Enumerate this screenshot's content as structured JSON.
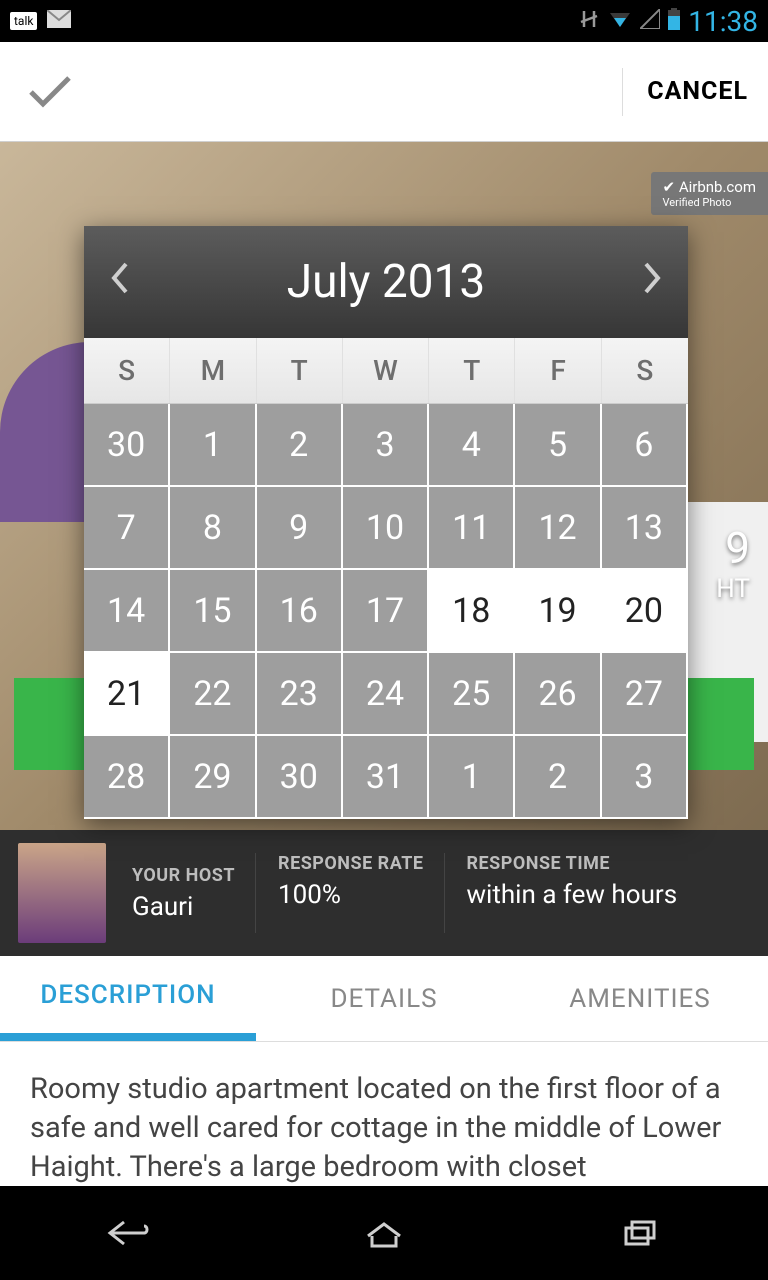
{
  "status": {
    "talk_label": "talk",
    "time": "11:38"
  },
  "appbar": {
    "cancel_label": "CANCEL"
  },
  "badge": {
    "line1": "Airbnb.com",
    "line2": "Verified Photo"
  },
  "price": {
    "amount": "9",
    "unit": "HT"
  },
  "calendar": {
    "title": "July 2013",
    "weekday_headers": [
      "S",
      "M",
      "T",
      "W",
      "T",
      "F",
      "S"
    ],
    "cells": [
      {
        "n": "30",
        "avail": false
      },
      {
        "n": "1",
        "avail": false
      },
      {
        "n": "2",
        "avail": false
      },
      {
        "n": "3",
        "avail": false
      },
      {
        "n": "4",
        "avail": false
      },
      {
        "n": "5",
        "avail": false
      },
      {
        "n": "6",
        "avail": false
      },
      {
        "n": "7",
        "avail": false
      },
      {
        "n": "8",
        "avail": false
      },
      {
        "n": "9",
        "avail": false
      },
      {
        "n": "10",
        "avail": false
      },
      {
        "n": "11",
        "avail": false
      },
      {
        "n": "12",
        "avail": false
      },
      {
        "n": "13",
        "avail": false
      },
      {
        "n": "14",
        "avail": false
      },
      {
        "n": "15",
        "avail": false
      },
      {
        "n": "16",
        "avail": false
      },
      {
        "n": "17",
        "avail": false
      },
      {
        "n": "18",
        "avail": true
      },
      {
        "n": "19",
        "avail": true
      },
      {
        "n": "20",
        "avail": true
      },
      {
        "n": "21",
        "avail": true
      },
      {
        "n": "22",
        "avail": false
      },
      {
        "n": "23",
        "avail": false
      },
      {
        "n": "24",
        "avail": false
      },
      {
        "n": "25",
        "avail": false
      },
      {
        "n": "26",
        "avail": false
      },
      {
        "n": "27",
        "avail": false
      },
      {
        "n": "28",
        "avail": false
      },
      {
        "n": "29",
        "avail": false
      },
      {
        "n": "30",
        "avail": false
      },
      {
        "n": "31",
        "avail": false
      },
      {
        "n": "1",
        "avail": false
      },
      {
        "n": "2",
        "avail": false
      },
      {
        "n": "3",
        "avail": false
      }
    ]
  },
  "host": {
    "your_host_label": "YOUR HOST",
    "your_host_value": "Gauri",
    "rate_label": "RESPONSE RATE",
    "rate_value": "100%",
    "time_label": "RESPONSE TIME",
    "time_value": "within a few hours"
  },
  "tabs": {
    "description": "DESCRIPTION",
    "details": "DETAILS",
    "amenities": "AMENITIES"
  },
  "description_text": "Roomy studio apartment located on the first floor of a safe and well cared for cottage in the middle of Lower Haight. There's a large bedroom with closet"
}
